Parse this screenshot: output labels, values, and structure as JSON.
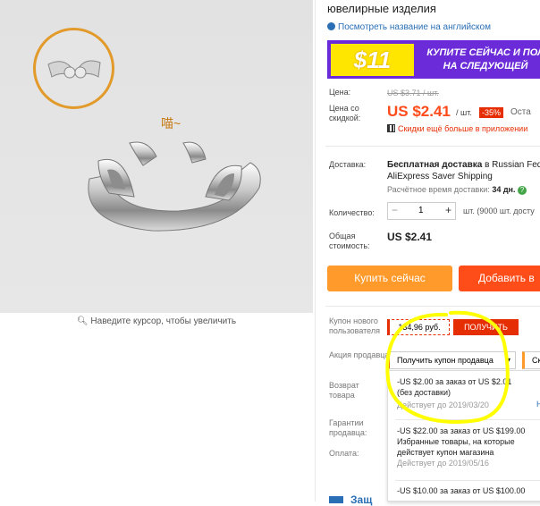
{
  "product": {
    "title_line": "ювелирные изделия",
    "translate_link": "Посмотреть название на английском"
  },
  "banner": {
    "badge": "$11",
    "line1": "КУПИТЕ СЕЙЧАС И ПОЛ",
    "line2": "НА СЛЕДУЮЩЕЙ"
  },
  "price": {
    "label": "Цена:",
    "old": "US $3.71 / шт.",
    "discount_label": "Цена со скидкой:",
    "current": "US $2.41",
    "unit": "/ шт.",
    "discount_badge": "-35%",
    "remaining": "Оста",
    "app_promo": "Скидки ещё больше в приложении"
  },
  "shipping": {
    "label": "Доставка:",
    "line1_bold": "Бесплатная доставка",
    "line1_rest": " в Russian Fede",
    "line2": "AliExpress Saver Shipping",
    "eta_label": "Расчётное время доставки:",
    "eta_value": "34 дн."
  },
  "quantity": {
    "label": "Количество:",
    "minus": "−",
    "value": "1",
    "plus": "+",
    "info": "шт. (9000 шт. досту"
  },
  "total": {
    "label": "Общая стоимость:",
    "value": "US $2.41"
  },
  "actions": {
    "buy": "Купить сейчас",
    "cart": "Добавить в"
  },
  "new_user": {
    "label": "Купон нового пользователя",
    "amount": "134,96 руб.",
    "button": "ПОЛУЧИТЬ"
  },
  "seller_promo": {
    "label": "Акция продавца:",
    "dropdown": "Получить купон продавца",
    "second": "Ск"
  },
  "returns": {
    "label": "Возврат товара"
  },
  "guarantee": {
    "label": "Гарантии продавца:"
  },
  "payment": {
    "label": "Оплата:"
  },
  "coupons": [
    {
      "title": "-US $2.00 за заказ от US $2.01",
      "note": "(без доставки)",
      "valid": "Действует до 2019/03/20",
      "extra": "Н"
    },
    {
      "title": "-US $22.00 за заказ от US $199.00",
      "note": "Избранные товары, на которые действует купон магазина",
      "valid": "Действует до 2019/05/16"
    },
    {
      "title": "-US $10.00 за заказ от US $100.00"
    }
  ],
  "bottom_link": "Защ",
  "image": {
    "zoom_hint": "Наведите курсор, чтобы увеличить",
    "caption_char": "喵~"
  },
  "colors": {
    "orange": "#ff4747",
    "buy": "#ff9a2b",
    "cart": "#ff4d1a",
    "red": "#e62e04",
    "highlight": "#ffff00"
  }
}
